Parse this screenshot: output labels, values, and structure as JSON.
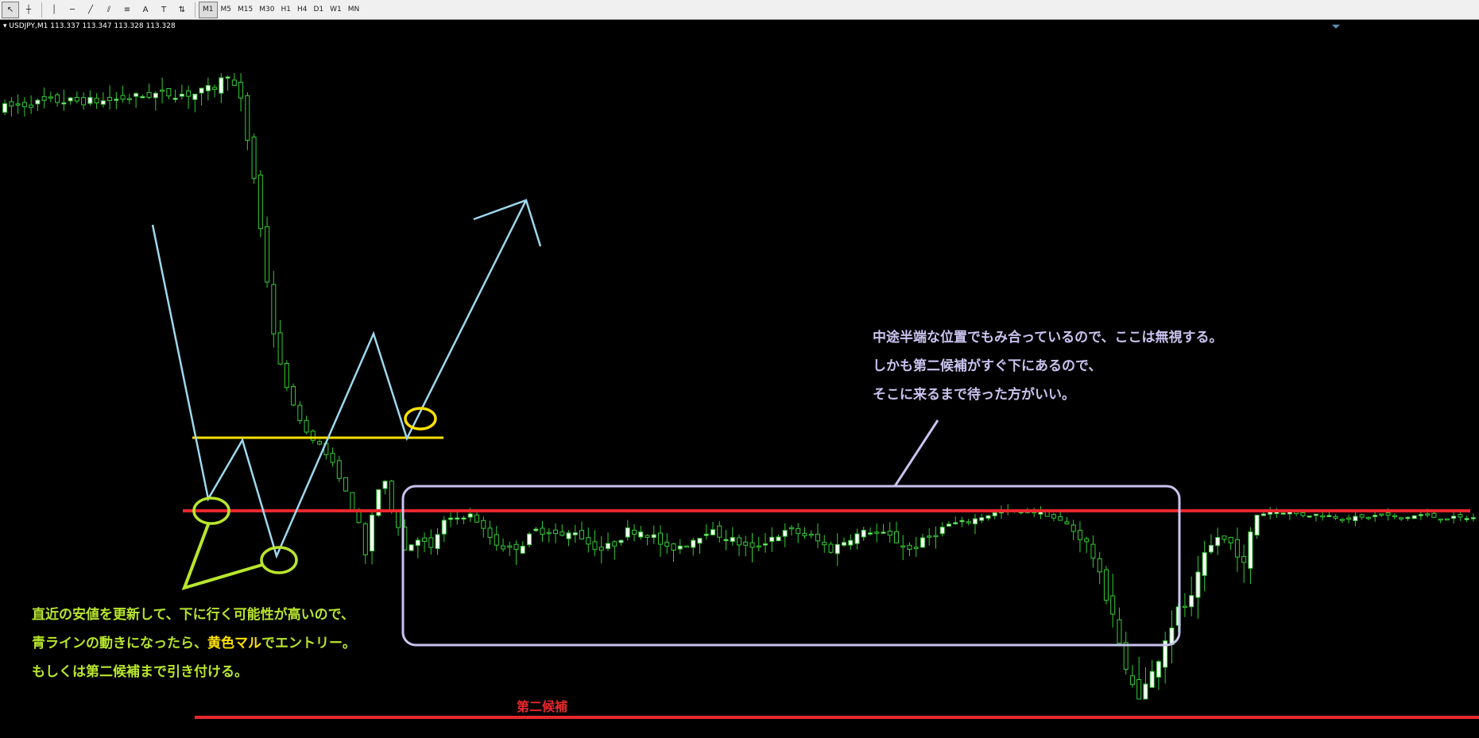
{
  "toolbar": {
    "tools": [
      {
        "name": "cursor-icon",
        "glyph": "↖"
      },
      {
        "name": "crosshair-icon",
        "glyph": "┼"
      },
      {
        "name": "vertical-line-icon",
        "glyph": "│"
      },
      {
        "name": "horizontal-line-icon",
        "glyph": "─"
      },
      {
        "name": "trendline-icon",
        "glyph": "╱"
      },
      {
        "name": "channel-icon",
        "glyph": "⫽"
      },
      {
        "name": "fibonacci-icon",
        "glyph": "≡"
      },
      {
        "name": "text-icon",
        "glyph": "A"
      },
      {
        "name": "text-label-icon",
        "glyph": "T"
      },
      {
        "name": "arrows-icon",
        "glyph": "⇅"
      }
    ],
    "timeframes": [
      "M1",
      "M5",
      "M15",
      "M30",
      "H1",
      "H4",
      "D1",
      "W1",
      "MN"
    ],
    "active_timeframe": "M1"
  },
  "header": {
    "symbol": "USDJPY,M1",
    "prices": "113.337 113.347 113.328 113.328"
  },
  "chart_data": {
    "type": "candlestick",
    "instrument": "USDJPY",
    "timeframe": "M1",
    "last_bar_ohlc": [
      113.337,
      113.347,
      113.328,
      113.328
    ],
    "background": "#000000",
    "bull_color": "#ffffff",
    "bear_color": "#000000",
    "wick_color": "#33cc33",
    "profile": [
      [
        0,
        95
      ],
      [
        8,
        96
      ],
      [
        16,
        96
      ],
      [
        24,
        97
      ],
      [
        30,
        97
      ],
      [
        33,
        98
      ],
      [
        35,
        100
      ],
      [
        37,
        96
      ],
      [
        39,
        85
      ],
      [
        41,
        70
      ],
      [
        43,
        55
      ],
      [
        45,
        42
      ],
      [
        47,
        34
      ],
      [
        49,
        30
      ],
      [
        51,
        24
      ],
      [
        52,
        20
      ],
      [
        53,
        15
      ],
      [
        54,
        10
      ],
      [
        55,
        5
      ],
      [
        56,
        0
      ],
      [
        57,
        8
      ],
      [
        58,
        16
      ],
      [
        59,
        18
      ],
      [
        60,
        10
      ],
      [
        61,
        5
      ],
      [
        62,
        1
      ],
      [
        64,
        3
      ],
      [
        66,
        1
      ],
      [
        68,
        6
      ],
      [
        70,
        7
      ],
      [
        72,
        8
      ],
      [
        74,
        4
      ],
      [
        75,
        3
      ],
      [
        76,
        2
      ],
      [
        78,
        1
      ],
      [
        80,
        2
      ],
      [
        82,
        4
      ],
      [
        84,
        4
      ],
      [
        86,
        3
      ],
      [
        88,
        4
      ],
      [
        90,
        2
      ],
      [
        92,
        1
      ],
      [
        94,
        2
      ],
      [
        96,
        4
      ],
      [
        98,
        4
      ],
      [
        100,
        3
      ],
      [
        102,
        1
      ],
      [
        105,
        2
      ],
      [
        108,
        4
      ],
      [
        111,
        3
      ],
      [
        115,
        1
      ],
      [
        118,
        3
      ],
      [
        121,
        4
      ],
      [
        124,
        3
      ],
      [
        127,
        1
      ],
      [
        130,
        3
      ],
      [
        133,
        4
      ],
      [
        136,
        3
      ],
      [
        139,
        1
      ],
      [
        142,
        3
      ],
      [
        145,
        5
      ],
      [
        148,
        6
      ],
      [
        151,
        8
      ],
      [
        153,
        9
      ],
      [
        155,
        9
      ],
      [
        158,
        9
      ],
      [
        160,
        8
      ],
      [
        162,
        6
      ],
      [
        164,
        4
      ],
      [
        166,
        2
      ],
      [
        168,
        -2
      ],
      [
        170,
        -5
      ],
      [
        172,
        -10
      ],
      [
        174,
        -12
      ],
      [
        176,
        -10
      ],
      [
        178,
        -7
      ],
      [
        180,
        -5
      ],
      [
        182,
        -4
      ],
      [
        184,
        0
      ],
      [
        186,
        3
      ],
      [
        188,
        2
      ],
      [
        190,
        -1
      ],
      [
        192,
        8
      ],
      [
        194,
        9
      ],
      [
        196,
        9
      ],
      [
        199,
        8
      ],
      [
        202,
        8
      ],
      [
        205,
        7
      ],
      [
        208,
        7
      ],
      [
        211,
        8
      ],
      [
        214,
        7
      ],
      [
        217,
        8
      ],
      [
        220,
        7
      ],
      [
        224,
        7
      ]
    ],
    "profile_note": "x = bar index, y = relative price level (100 = session high, 0 = spike low)"
  },
  "annotations": {
    "note_left": {
      "line1": "直近の安値を更新して、下に行く可能性が高いので、",
      "line2_pre": "青ラインの動きになったら、",
      "line2_highlight": "黄色マル",
      "line2_post": "でエントリー。",
      "line3": "もしくは第二候補まで引き付ける。"
    },
    "note_right": {
      "line1": "中途半端な位置でもみ合っているので、ここは無視する。",
      "line2": "しかも第二候補がすぐ下にあるので、",
      "line3": "そこに来るまで待った方がいい。"
    },
    "second_candidate_label": "第二候補",
    "colors": {
      "red_line": "#e8282d",
      "yellow": "#ffe100",
      "yellow_green": "#b8e62c",
      "light_blue": "#9ed8ee",
      "lavender": "#c9c3ef"
    }
  }
}
